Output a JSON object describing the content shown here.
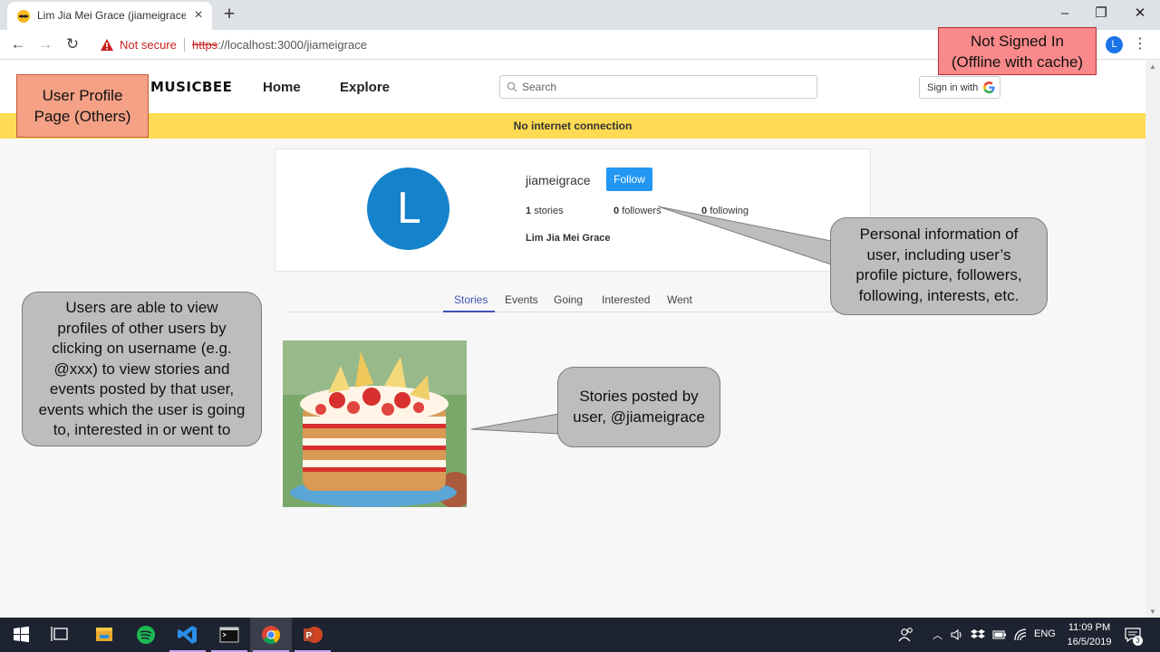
{
  "browser": {
    "tab_title": "Lim Jia Mei Grace (jiameigrace) -",
    "tab_close": "×",
    "new_tab": "+",
    "not_secure": "Not secure",
    "url_protocol": "https",
    "url_rest": "://localhost:3000/jiameigrace",
    "profile_initial": "L",
    "minimize": "–",
    "restore": "❐",
    "close": "✕",
    "back": "←",
    "forward": "→",
    "reload": "↻",
    "menu": "⋮"
  },
  "site": {
    "logo": "MUSICBEE",
    "nav": {
      "home": "Home",
      "explore": "Explore"
    },
    "search_placeholder": "Search",
    "signin_label": "Sign in with",
    "offline_banner": "No internet connection"
  },
  "profile": {
    "avatar_initial": "L",
    "username": "jiameigrace",
    "follow_label": "Follow",
    "stories_count": "1",
    "stories_label": "stories",
    "followers_count": "0",
    "followers_label": "followers",
    "following_count": "0",
    "following_label": "following",
    "full_name": "Lim Jia Mei Grace",
    "tabs": [
      "Stories",
      "Events",
      "Going",
      "Interested",
      "Went"
    ],
    "active_tab": "Stories"
  },
  "annotations": {
    "page_label": [
      "User Profile",
      "Page (Others)"
    ],
    "status_label": [
      "Not Signed In",
      "(Offline with cache)"
    ],
    "callout_personal": [
      "Personal information of",
      "user, including user’s",
      "profile picture, followers,",
      "following, interests, etc."
    ],
    "callout_users": [
      "Users are able to view",
      "profiles of other users by",
      "clicking on username (e.g.",
      "@xxx) to view stories and",
      "events posted by that user,",
      "events which the user is going",
      "to, interested in or went to"
    ],
    "callout_stories": [
      "Stories posted by",
      "user, @jiameigrace"
    ]
  },
  "taskbar": {
    "language": "ENG",
    "time": "11:09 PM",
    "date": "16/5/2019",
    "notification_count": "3",
    "apps": [
      "start-icon",
      "task-view-icon",
      "file-explorer-icon",
      "spotify-icon",
      "vscode-icon",
      "terminal-icon",
      "chrome-icon",
      "powerpoint-icon"
    ]
  },
  "colors": {
    "banner": "#fedb52",
    "avatar": "#1483cc",
    "follow_button": "#2196f3",
    "active_tab": "#3f51b5",
    "page_label_box": "#f4a185",
    "status_label_box": "#f9898a",
    "callout": "#bdbdbd"
  }
}
